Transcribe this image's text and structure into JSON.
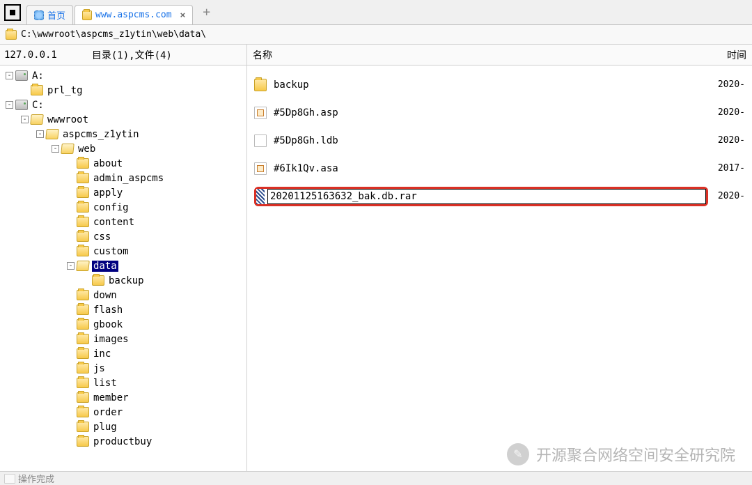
{
  "tabs": {
    "home_label": "首页",
    "url_label": "www.aspcms.com",
    "close_glyph": "×",
    "add_glyph": "+"
  },
  "address": {
    "path": "C:\\wwwroot\\aspcms_z1ytin\\web\\data\\"
  },
  "headers": {
    "ip": "127.0.0.1",
    "dirinfo": "目录(1),文件(4)",
    "name_col": "名称",
    "time_col": "时间"
  },
  "tree": [
    {
      "indent": 0,
      "toggle": "-",
      "icon": "drive",
      "label": "A:"
    },
    {
      "indent": 1,
      "toggle": "",
      "icon": "folder",
      "label": "prl_tg"
    },
    {
      "indent": 0,
      "toggle": "-",
      "icon": "drive",
      "label": "C:"
    },
    {
      "indent": 1,
      "toggle": "-",
      "icon": "folder-open",
      "label": "wwwroot"
    },
    {
      "indent": 2,
      "toggle": "-",
      "icon": "folder-open",
      "label": "aspcms_z1ytin"
    },
    {
      "indent": 3,
      "toggle": "-",
      "icon": "folder-open",
      "label": "web"
    },
    {
      "indent": 4,
      "toggle": "",
      "icon": "folder",
      "label": "about"
    },
    {
      "indent": 4,
      "toggle": "",
      "icon": "folder",
      "label": "admin_aspcms"
    },
    {
      "indent": 4,
      "toggle": "",
      "icon": "folder",
      "label": "apply"
    },
    {
      "indent": 4,
      "toggle": "",
      "icon": "folder",
      "label": "config"
    },
    {
      "indent": 4,
      "toggle": "",
      "icon": "folder",
      "label": "content"
    },
    {
      "indent": 4,
      "toggle": "",
      "icon": "folder",
      "label": "css"
    },
    {
      "indent": 4,
      "toggle": "",
      "icon": "folder",
      "label": "custom"
    },
    {
      "indent": 4,
      "toggle": "-",
      "icon": "folder-open",
      "label": "data",
      "selected": true
    },
    {
      "indent": 5,
      "toggle": "",
      "icon": "folder",
      "label": "backup"
    },
    {
      "indent": 4,
      "toggle": "",
      "icon": "folder",
      "label": "down"
    },
    {
      "indent": 4,
      "toggle": "",
      "icon": "folder",
      "label": "flash"
    },
    {
      "indent": 4,
      "toggle": "",
      "icon": "folder",
      "label": "gbook"
    },
    {
      "indent": 4,
      "toggle": "",
      "icon": "folder",
      "label": "images"
    },
    {
      "indent": 4,
      "toggle": "",
      "icon": "folder",
      "label": "inc"
    },
    {
      "indent": 4,
      "toggle": "",
      "icon": "folder",
      "label": "js"
    },
    {
      "indent": 4,
      "toggle": "",
      "icon": "folder",
      "label": "list"
    },
    {
      "indent": 4,
      "toggle": "",
      "icon": "folder",
      "label": "member"
    },
    {
      "indent": 4,
      "toggle": "",
      "icon": "folder",
      "label": "order"
    },
    {
      "indent": 4,
      "toggle": "",
      "icon": "folder",
      "label": "plug"
    },
    {
      "indent": 4,
      "toggle": "",
      "icon": "folder",
      "label": "productbuy"
    }
  ],
  "files": [
    {
      "icon": "folder",
      "name": "backup",
      "time": "2020-"
    },
    {
      "icon": "file-asp",
      "name": "#5Dp8Gh.asp",
      "time": "2020-"
    },
    {
      "icon": "file",
      "name": "#5Dp8Gh.ldb",
      "time": "2020-"
    },
    {
      "icon": "file-asp",
      "name": "#6Ik1Qv.asa",
      "time": "2017-"
    },
    {
      "icon": "rar",
      "name": "20201125163632_bak.db.rar",
      "time": "2020-",
      "editing": true
    }
  ],
  "status": {
    "text": "操作完成"
  },
  "watermark": {
    "text": "开源聚合网络空间安全研究院",
    "icon_glyph": "✎"
  }
}
